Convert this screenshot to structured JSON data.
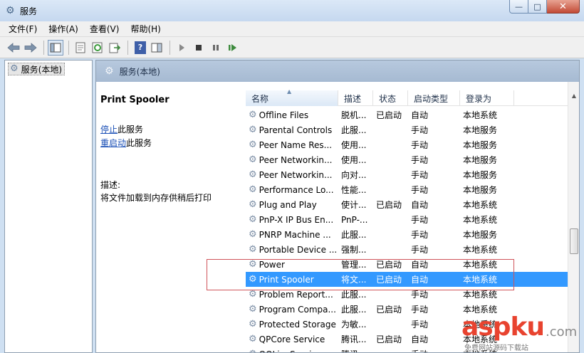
{
  "window": {
    "title": "服务",
    "controls": {
      "minimize": "—",
      "maximize": "□",
      "close": "✕"
    }
  },
  "menu": [
    "文件(F)",
    "操作(A)",
    "查看(V)",
    "帮助(H)"
  ],
  "toolbar": {
    "icons": [
      "back-arrow-icon",
      "forward-arrow-icon",
      "show-hide-tree-icon",
      "properties-icon",
      "refresh-icon",
      "export-list-icon",
      "help-icon",
      "show-action-pane-icon",
      "start-service-icon",
      "stop-service-icon",
      "pause-service-icon",
      "restart-service-icon"
    ],
    "help_label": "?"
  },
  "tree": {
    "root_label": "服务(本地)"
  },
  "pane": {
    "title": "服务(本地)"
  },
  "description": {
    "service_name": "Print Spooler",
    "stop_link": "停止",
    "stop_suffix": "此服务",
    "restart_link": "重启动",
    "restart_suffix": "此服务",
    "desc_label": "描述:",
    "desc_text": "将文件加载到内存供稍后打印"
  },
  "columns": [
    "名称",
    "描述",
    "状态",
    "启动类型",
    "登录为"
  ],
  "services": [
    {
      "name": "Offline Files",
      "desc": "脱机...",
      "status": "已启动",
      "startup": "自动",
      "logon": "本地系统"
    },
    {
      "name": "Parental Controls",
      "desc": "此服...",
      "status": "",
      "startup": "手动",
      "logon": "本地服务"
    },
    {
      "name": "Peer Name Res...",
      "desc": "使用...",
      "status": "",
      "startup": "手动",
      "logon": "本地服务"
    },
    {
      "name": "Peer Networkin...",
      "desc": "使用...",
      "status": "",
      "startup": "手动",
      "logon": "本地服务"
    },
    {
      "name": "Peer Networkin...",
      "desc": "向对...",
      "status": "",
      "startup": "手动",
      "logon": "本地服务"
    },
    {
      "name": "Performance Lo...",
      "desc": "性能...",
      "status": "",
      "startup": "手动",
      "logon": "本地服务"
    },
    {
      "name": "Plug and Play",
      "desc": "使计...",
      "status": "已启动",
      "startup": "自动",
      "logon": "本地系统"
    },
    {
      "name": "PnP-X IP Bus En...",
      "desc": "PnP-...",
      "status": "",
      "startup": "手动",
      "logon": "本地系统"
    },
    {
      "name": "PNRP Machine ...",
      "desc": "此服...",
      "status": "",
      "startup": "手动",
      "logon": "本地服务"
    },
    {
      "name": "Portable Device ...",
      "desc": "强制...",
      "status": "",
      "startup": "手动",
      "logon": "本地系统"
    },
    {
      "name": "Power",
      "desc": "管理...",
      "status": "已启动",
      "startup": "自动",
      "logon": "本地系统"
    },
    {
      "name": "Print Spooler",
      "desc": "将文...",
      "status": "已启动",
      "startup": "自动",
      "logon": "本地系统",
      "selected": true
    },
    {
      "name": "Problem Report...",
      "desc": "此服...",
      "status": "",
      "startup": "手动",
      "logon": "本地系统"
    },
    {
      "name": "Program Compa...",
      "desc": "此服...",
      "status": "已启动",
      "startup": "手动",
      "logon": "本地系统"
    },
    {
      "name": "Protected Storage",
      "desc": "为敏...",
      "status": "",
      "startup": "手动",
      "logon": "本地系统"
    },
    {
      "name": "QPCore Service",
      "desc": "腾讯...",
      "status": "已启动",
      "startup": "自动",
      "logon": "本地系统"
    },
    {
      "name": "QQLiveService",
      "desc": "腾讯...",
      "status": "",
      "startup": "手动",
      "logon": "本地系统"
    }
  ],
  "watermark": {
    "main": "aspku",
    "suffix": ".com",
    "sub": "免费网站源码下载站"
  },
  "colors": {
    "selection": "#3399ff",
    "link": "#1a4fb6",
    "highlight_box": "#d0545a",
    "watermark": "#e8432f"
  }
}
